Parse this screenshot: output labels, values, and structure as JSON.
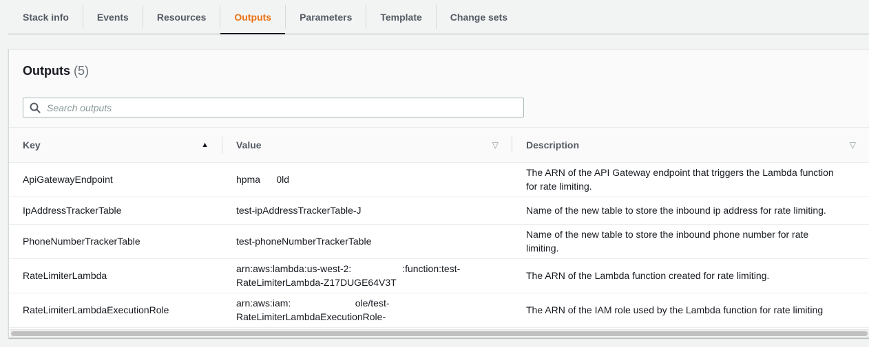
{
  "tabs": [
    {
      "label": "Stack info",
      "active": false
    },
    {
      "label": "Events",
      "active": false
    },
    {
      "label": "Resources",
      "active": false
    },
    {
      "label": "Outputs",
      "active": true
    },
    {
      "label": "Parameters",
      "active": false
    },
    {
      "label": "Template",
      "active": false
    },
    {
      "label": "Change sets",
      "active": false
    }
  ],
  "panel": {
    "title": "Outputs",
    "count": "(5)"
  },
  "search": {
    "placeholder": "Search outputs",
    "value": ""
  },
  "table": {
    "columns": [
      {
        "label": "Key",
        "sort": "ascending"
      },
      {
        "label": "Value",
        "sort": "none"
      },
      {
        "label": "Description",
        "sort": "none"
      }
    ],
    "rows": [
      {
        "key": "ApiGatewayEndpoint",
        "value_lines": [
          "hpma      0ld"
        ],
        "description_lines": [
          "The ARN of the API Gateway endpoint that triggers the Lambda function",
          "for rate limiting."
        ]
      },
      {
        "key": "IpAddressTrackerTable",
        "value_lines": [
          "test-ipAddressTrackerTable-J"
        ],
        "description_lines": [
          "Name of the new table to store the inbound ip address for rate limiting."
        ]
      },
      {
        "key": "PhoneNumberTrackerTable",
        "value_lines": [
          "test-phoneNumberTrackerTable"
        ],
        "description_lines": [
          "Name of the new table to store the inbound phone number for rate",
          "limiting."
        ]
      },
      {
        "key": "RateLimiterLambda",
        "value_lines": [
          "arn:aws:lambda:us-west-2:                   :function:test-",
          "RateLimiterLambda-Z17DUGE64V3T"
        ],
        "description_lines": [
          "The ARN of the Lambda function created for rate limiting."
        ]
      },
      {
        "key": "RateLimiterLambdaExecutionRole",
        "value_lines": [
          "arn:aws:iam:                        ole/test-",
          "RateLimiterLambdaExecutionRole-"
        ],
        "description_lines": [
          "The ARN of the IAM role used by the Lambda function for rate limiting"
        ]
      }
    ]
  },
  "colors": {
    "accent": "#ec7211",
    "text": "#16191f",
    "muted": "#545b64",
    "background": "#f2f3f3"
  },
  "icons": {
    "search": "search-icon",
    "sort_asc": "caret-up-icon",
    "sort_none": "caret-down-outline-icon"
  }
}
